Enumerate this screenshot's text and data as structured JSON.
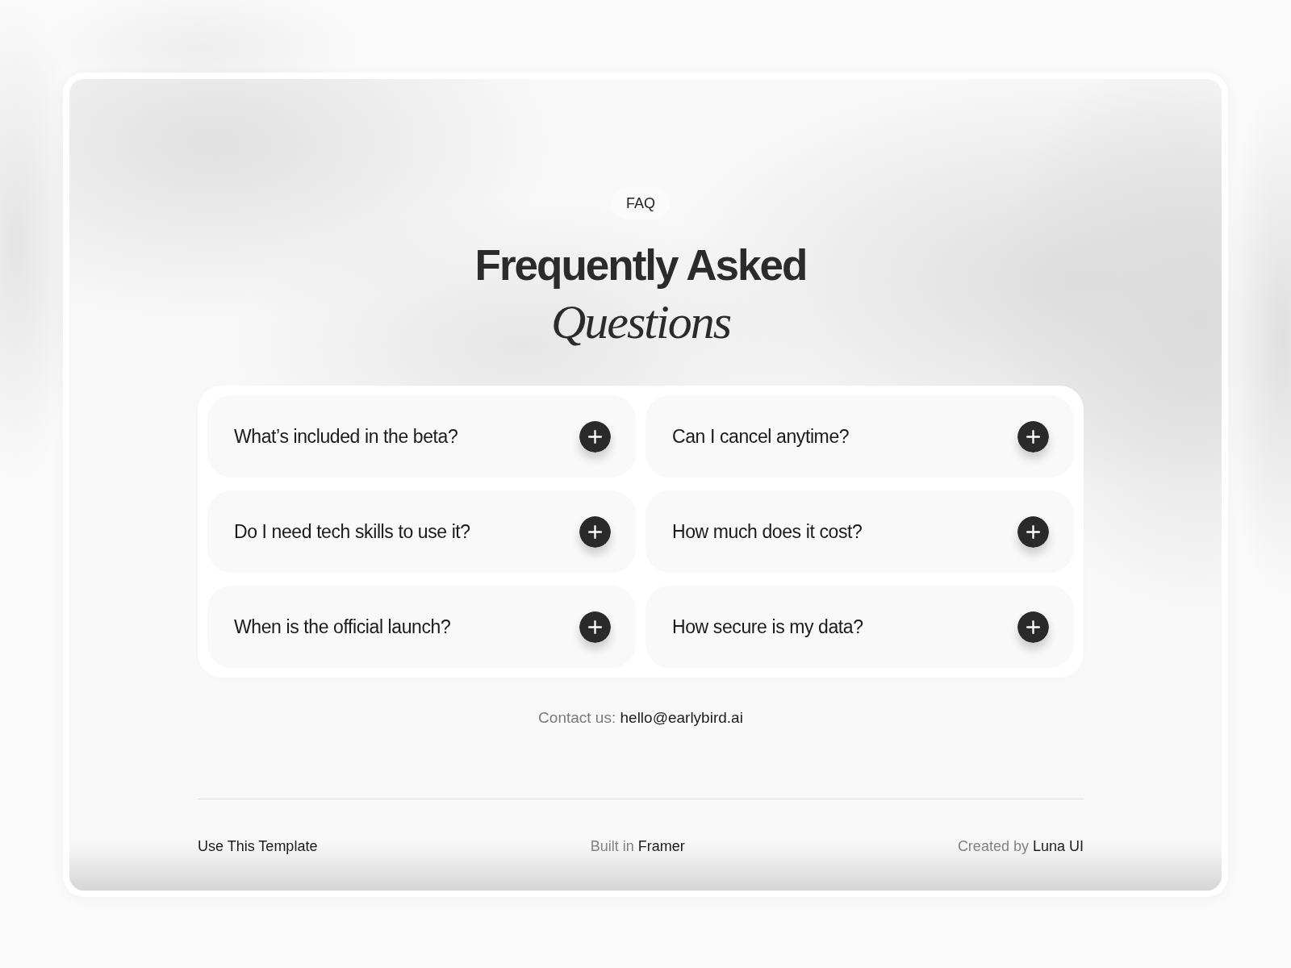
{
  "eyebrow": "FAQ",
  "heading": {
    "line_1": "Frequently Asked",
    "line_2": "Questions"
  },
  "faq_items": [
    {
      "question": "What’s included in the beta?",
      "expanded": false
    },
    {
      "question": "Can I cancel anytime?",
      "expanded": false
    },
    {
      "question": "Do I need tech skills to use it?",
      "expanded": false
    },
    {
      "question": "How much does it cost?",
      "expanded": false
    },
    {
      "question": "When is the official launch?",
      "expanded": false
    },
    {
      "question": "How secure is my data?",
      "expanded": false
    }
  ],
  "contact": {
    "label": "Contact us:",
    "email": "hello@earlybird.ai"
  },
  "footer": {
    "template_link": "Use This Template",
    "built_in": {
      "prefix": "Built in",
      "name": "Framer"
    },
    "created_by": {
      "prefix": "Created by",
      "name": "Luna UI"
    }
  }
}
